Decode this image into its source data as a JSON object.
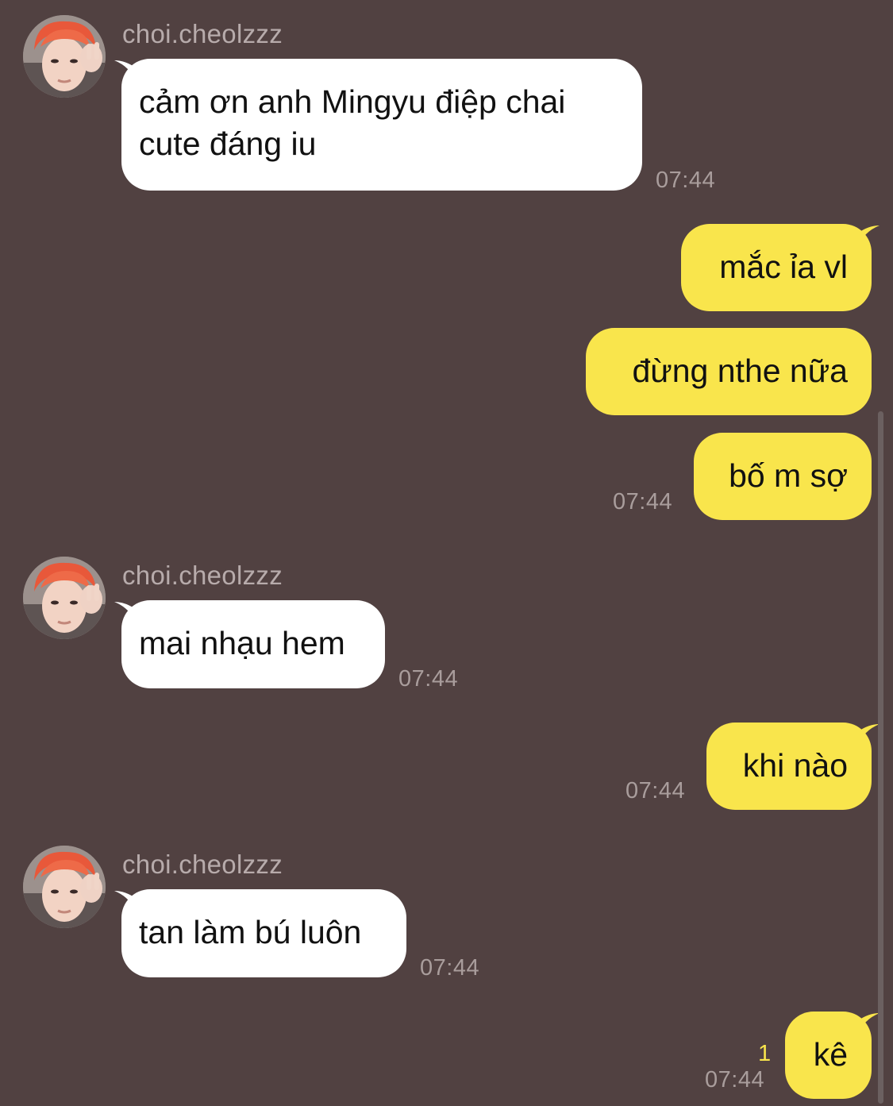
{
  "theme": {
    "background": "#514141",
    "incoming_bubble": "#ffffff",
    "outgoing_bubble": "#f9e54c",
    "timestamp_color": "#a99d9c",
    "unread_color": "#f9e54c"
  },
  "contact": {
    "name": "choi.cheolzzz",
    "avatar_icon": "profile-photo-avatar"
  },
  "messages": [
    {
      "direction": "in",
      "sender": "choi.cheolzzz",
      "text": "cảm ơn anh Mingyu điệp chai\ncute đáng iu",
      "time": "07:44"
    },
    {
      "direction": "out",
      "text": "mắc ỉa vl",
      "time": ""
    },
    {
      "direction": "out",
      "text": "đừng nthe nữa",
      "time": ""
    },
    {
      "direction": "out",
      "text": "bố m sợ",
      "time": "07:44"
    },
    {
      "direction": "in",
      "sender": "choi.cheolzzz",
      "text": "mai nhạu hem",
      "time": "07:44"
    },
    {
      "direction": "out",
      "text": "khi nào",
      "time": "07:44"
    },
    {
      "direction": "in",
      "sender": "choi.cheolzzz",
      "text": "tan làm bú luôn",
      "time": "07:44"
    },
    {
      "direction": "out",
      "text": "kê",
      "time": "07:44",
      "unread": "1"
    }
  ]
}
